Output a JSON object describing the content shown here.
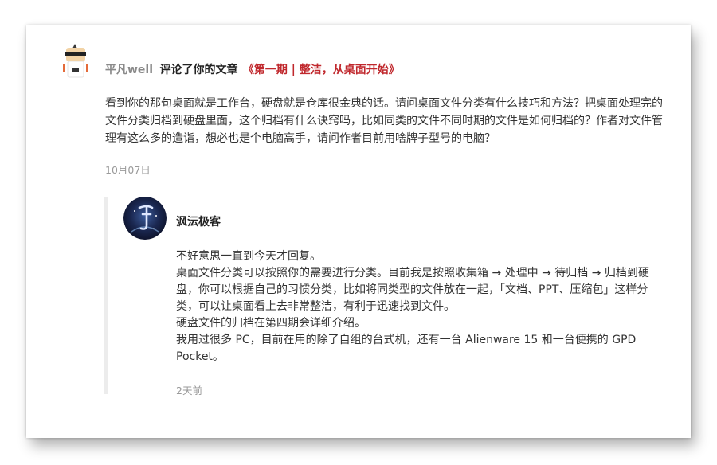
{
  "comment": {
    "user": "平凡well",
    "action": "评论了你的文章",
    "article_title": "《第一期 | 整洁，从桌面开始》",
    "text": "看到你的那句桌面就是工作台，硬盘就是仓库很金典的话。请问桌面文件分类有什么技巧和方法？把桌面处理完的文件分类归档到硬盘里面，这个归档有什么诀窍吗，比如同类的文件不同时期的文件是如何归档的？作者对文件管理有这么多的造诣，想必也是个电脑高手，请问作者目前用啥牌子型号的电脑？",
    "date": "10月07日"
  },
  "reply": {
    "user": "沨沄极客",
    "paragraphs": [
      "不好意思一直到今天才回复。",
      "桌面文件分类可以按照你的需要进行分类。目前我是按照收集箱 → 处理中 → 待归档 → 归档到硬盘，你可以根据自己的习惯分类，比如将同类型的文件放在一起，「文档、PPT、压缩包」这样分类，可以让桌面看上去非常整洁，有利于迅速找到文件。",
      "硬盘文件的归档在第四期会详细介绍。",
      "我用过很多 PC，目前在用的除了自组的台式机，还有一台 Alienware 15 和一台便携的 GPD Pocket。"
    ],
    "date": "2天前"
  },
  "colors": {
    "article_link": "#c0282d",
    "muted": "#9a9a9a"
  }
}
